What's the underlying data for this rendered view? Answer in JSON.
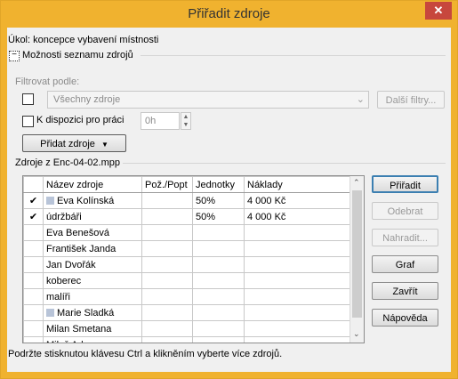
{
  "window": {
    "title": "Přiřadit zdroje",
    "close_glyph": "✕"
  },
  "task_label": "Úkol: koncepce vybavení místnosti",
  "options_toggle": "−",
  "options_label": "Možnosti seznamu zdrojů",
  "filter": {
    "label": "Filtrovat podle:",
    "value": "Všechny zdroje",
    "more_button": "Další filtry..."
  },
  "availability": {
    "label": "K dispozici pro práci",
    "value": "0h"
  },
  "add_resources_button": "Přidat zdroje",
  "resources_from": "Zdroje z Enc-04-02.mpp",
  "table": {
    "headers": [
      "",
      "Název zdroje",
      "Pož./Popt",
      "Jednotky",
      "Náklady"
    ],
    "rows": [
      {
        "check": "✔",
        "name": "Eva Kolínská",
        "icon": true,
        "req": "",
        "units": "50%",
        "cost": "4 000 Kč"
      },
      {
        "check": "✔",
        "name": "údržbáři",
        "icon": false,
        "req": "",
        "units": "50%",
        "cost": "4 000 Kč"
      },
      {
        "check": "",
        "name": "Eva Benešová",
        "icon": false,
        "req": "",
        "units": "",
        "cost": ""
      },
      {
        "check": "",
        "name": "František Janda",
        "icon": false,
        "req": "",
        "units": "",
        "cost": ""
      },
      {
        "check": "",
        "name": "Jan Dvořák",
        "icon": false,
        "req": "",
        "units": "",
        "cost": ""
      },
      {
        "check": "",
        "name": "koberec",
        "icon": false,
        "req": "",
        "units": "",
        "cost": ""
      },
      {
        "check": "",
        "name": "malíři",
        "icon": false,
        "req": "",
        "units": "",
        "cost": ""
      },
      {
        "check": "",
        "name": "Marie Sladká",
        "icon": true,
        "req": "",
        "units": "",
        "cost": ""
      },
      {
        "check": "",
        "name": "Milan Smetana",
        "icon": false,
        "req": "",
        "units": "",
        "cost": ""
      },
      {
        "check": "",
        "name": "Miloš Adamec",
        "icon": false,
        "req": "",
        "units": "",
        "cost": ""
      }
    ]
  },
  "buttons": {
    "assign": "Přiřadit",
    "remove": "Odebrat",
    "replace": "Nahradit...",
    "graph": "Graf",
    "close": "Zavřít",
    "help": "Nápověda"
  },
  "hint": "Podržte stisknutou klávesu Ctrl a klikněním vyberte více zdrojů."
}
